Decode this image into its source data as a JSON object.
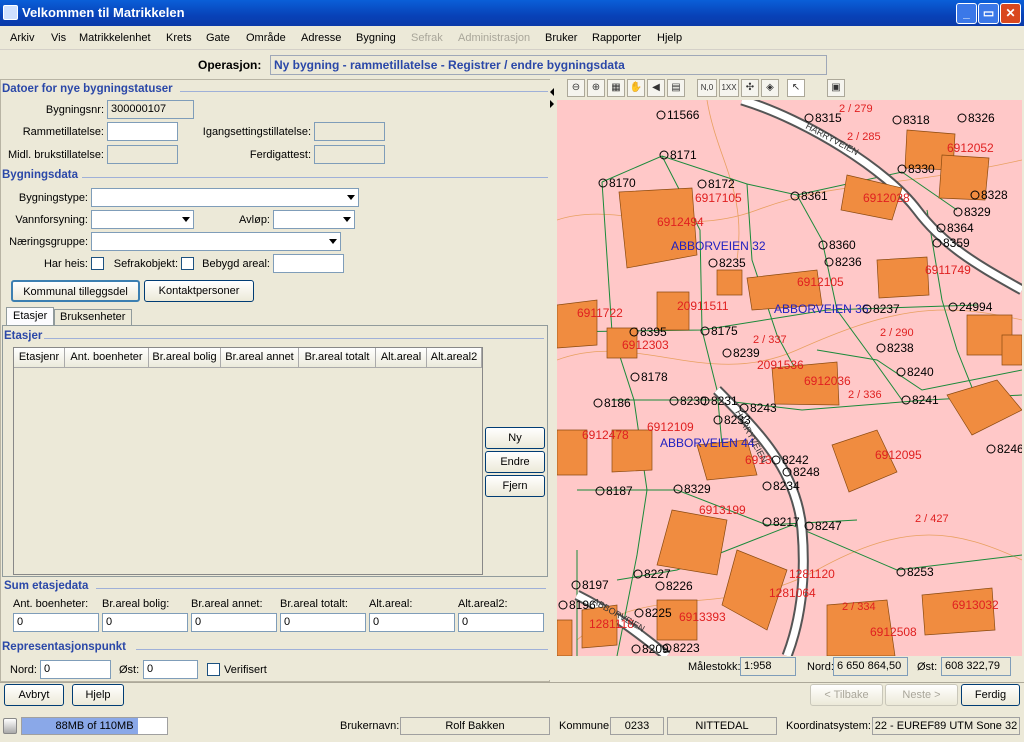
{
  "window": {
    "title": "Velkommen til Matrikkelen",
    "min": "_",
    "max": "▭",
    "close": "✕"
  },
  "menu": [
    {
      "label": "Arkiv",
      "disabled": false
    },
    {
      "label": "Vis",
      "disabled": false
    },
    {
      "label": "Matrikkelenhet",
      "disabled": false
    },
    {
      "label": "Krets",
      "disabled": false
    },
    {
      "label": "Gate",
      "disabled": false
    },
    {
      "label": "Område",
      "disabled": false
    },
    {
      "label": "Adresse",
      "disabled": false
    },
    {
      "label": "Bygning",
      "disabled": false
    },
    {
      "label": "Sefrak",
      "disabled": true
    },
    {
      "label": "Administrasjon",
      "disabled": true
    },
    {
      "label": "Bruker",
      "disabled": false
    },
    {
      "label": "Rapporter",
      "disabled": false
    },
    {
      "label": "Hjelp",
      "disabled": false
    }
  ],
  "operation": {
    "label": "Operasjon:",
    "value": "Ny bygning - rammetillatelse - Registrer / endre bygningsdata"
  },
  "datoer": {
    "title": "Datoer for nye bygningstatuser",
    "bygningsnr_label": "Bygningsnr:",
    "bygningsnr": "300000107",
    "ramme_label": "Rammetillatelse:",
    "igang_label": "Igangsettingstillatelse:",
    "midl_label": "Midl. brukstillatelse:",
    "ferdig_label": "Ferdigattest:"
  },
  "bygningsdata": {
    "title": "Bygningsdata",
    "type_label": "Bygningstype:",
    "vann_label": "Vannforsyning:",
    "avlop_label": "Avløp:",
    "naering_label": "Næringsgruppe:",
    "heis_label": "Har heis:",
    "sefrak_label": "Sefrakobjekt:",
    "areal_label": "Bebygd areal:",
    "kommunal_btn": "Kommunal tilleggsdel",
    "kontakt_btn": "Kontaktpersoner"
  },
  "tabs": [
    "Etasjer",
    "Bruksenheter"
  ],
  "etasjer": {
    "title": "Etasjer",
    "columns": [
      "Etasjenr",
      "Ant. boenheter",
      "Br.areal bolig",
      "Br.areal annet",
      "Br.areal totalt",
      "Alt.areal",
      "Alt.areal2"
    ],
    "ny": "Ny",
    "endre": "Endre",
    "fjern": "Fjern"
  },
  "sum": {
    "title": "Sum etasjedata",
    "labels": [
      "Ant. boenheter:",
      "Br.areal bolig:",
      "Br.areal annet:",
      "Br.areal totalt:",
      "Alt.areal:",
      "Alt.areal2:"
    ],
    "values": [
      "0",
      "0",
      "0",
      "0",
      "0",
      "0"
    ]
  },
  "rep": {
    "title": "Representasjonspunkt",
    "nord_label": "Nord:",
    "nord": "0",
    "ost_label": "Øst:",
    "ost": "0",
    "verifisert": "Verifisert"
  },
  "buttons": {
    "avbryt": "Avbryt",
    "hjelp": "Hjelp",
    "tilbake": "< Tilbake",
    "neste": "Neste >",
    "ferdig": "Ferdig"
  },
  "mapstatus": {
    "scale_label": "Målestokk:",
    "scale": "1:958",
    "nord_label": "Nord:",
    "nord": "6 650 864,50",
    "ost_label": "Øst:",
    "ost": "608 322,79"
  },
  "status": {
    "memory": "88MB of 110MB",
    "memory_fraction": 0.8,
    "user_label": "Brukernavn:",
    "user": "Rolf Bakken",
    "kommune_label": "Kommune:",
    "kommune_nr": "0233",
    "kommune_navn": "NITTEDAL",
    "coord_label": "Koordinatsystem:",
    "coord": "22 - EUREF89 UTM Sone 32"
  },
  "map": {
    "colors": {
      "bg": "#ffc8c8",
      "building": "#f08c40",
      "red": "#e02020",
      "blue": "#2020c0",
      "line": "#1a8a3a"
    },
    "roads": [
      "HARRYVEIEN",
      "HARRYVEIEN",
      "ABBORVEIEN"
    ],
    "points": [
      "11566",
      "8171",
      "8170",
      "8172",
      "8315",
      "8318",
      "8326",
      "8330",
      "8328",
      "8329",
      "8361",
      "8364",
      "8359",
      "8360",
      "8236",
      "8237",
      "8235",
      "8175",
      "8395",
      "8239",
      "8238",
      "8178",
      "8186",
      "8230",
      "8231",
      "8233",
      "8243",
      "8240",
      "8241",
      "8242",
      "8248",
      "8234",
      "8246",
      "8329",
      "8187",
      "8217",
      "8247",
      "8227",
      "8226",
      "8197",
      "8225",
      "8253",
      "8223",
      "8209",
      "8196",
      "24994"
    ],
    "parcels": [
      "6912052",
      "6912028",
      "6917105",
      "6912494",
      "6911749",
      "6912105",
      "20911511",
      "6911722",
      "6912303",
      "2091536",
      "6912036",
      "6912109",
      "6912478",
      "6913",
      "6912095",
      "6913199",
      "1281120",
      "1281064",
      "6913032",
      "6913393",
      "6912508",
      "1281118",
      "6918"
    ],
    "addresses": [
      "ABBORVEIEN 32",
      "ABBORVEIEN 36",
      "ABBORVEIEN 44"
    ],
    "red_labels": [
      "2 / 279",
      "2 / 285",
      "2 / 337",
      "2 / 290",
      "2 / 336",
      "2 / 427",
      "2 / 334"
    ]
  }
}
